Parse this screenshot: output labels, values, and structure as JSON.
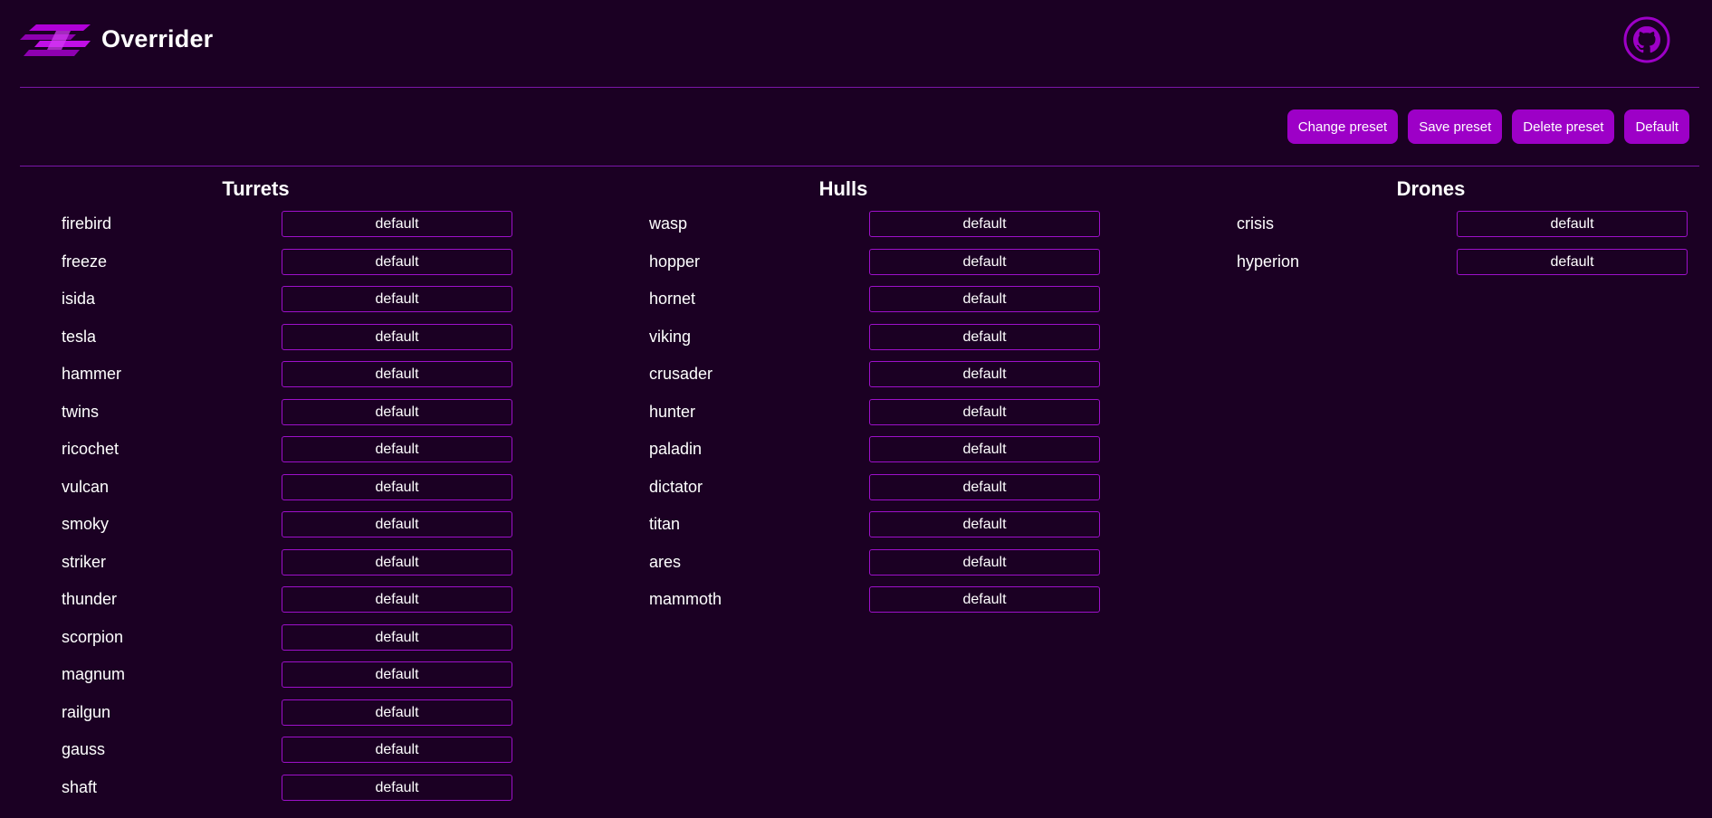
{
  "app": {
    "title": "Overrider"
  },
  "icons": {
    "logo": "overrider-logo",
    "github": "github-icon"
  },
  "colors": {
    "background": "#1b0023",
    "accent": "#9d00c7",
    "border": "#7a16a8"
  },
  "toolbar": {
    "change_preset": "Change preset",
    "save_preset": "Save preset",
    "delete_preset": "Delete preset",
    "default": "Default"
  },
  "turrets": {
    "title": "Turrets",
    "items": [
      {
        "name": "firebird",
        "value": "default"
      },
      {
        "name": "freeze",
        "value": "default"
      },
      {
        "name": "isida",
        "value": "default"
      },
      {
        "name": "tesla",
        "value": "default"
      },
      {
        "name": "hammer",
        "value": "default"
      },
      {
        "name": "twins",
        "value": "default"
      },
      {
        "name": "ricochet",
        "value": "default"
      },
      {
        "name": "vulcan",
        "value": "default"
      },
      {
        "name": "smoky",
        "value": "default"
      },
      {
        "name": "striker",
        "value": "default"
      },
      {
        "name": "thunder",
        "value": "default"
      },
      {
        "name": "scorpion",
        "value": "default"
      },
      {
        "name": "magnum",
        "value": "default"
      },
      {
        "name": "railgun",
        "value": "default"
      },
      {
        "name": "gauss",
        "value": "default"
      },
      {
        "name": "shaft",
        "value": "default"
      }
    ]
  },
  "hulls": {
    "title": "Hulls",
    "items": [
      {
        "name": "wasp",
        "value": "default"
      },
      {
        "name": "hopper",
        "value": "default"
      },
      {
        "name": "hornet",
        "value": "default"
      },
      {
        "name": "viking",
        "value": "default"
      },
      {
        "name": "crusader",
        "value": "default"
      },
      {
        "name": "hunter",
        "value": "default"
      },
      {
        "name": "paladin",
        "value": "default"
      },
      {
        "name": "dictator",
        "value": "default"
      },
      {
        "name": "titan",
        "value": "default"
      },
      {
        "name": "ares",
        "value": "default"
      },
      {
        "name": "mammoth",
        "value": "default"
      }
    ]
  },
  "drones": {
    "title": "Drones",
    "items": [
      {
        "name": "crisis",
        "value": "default"
      },
      {
        "name": "hyperion",
        "value": "default"
      }
    ]
  }
}
